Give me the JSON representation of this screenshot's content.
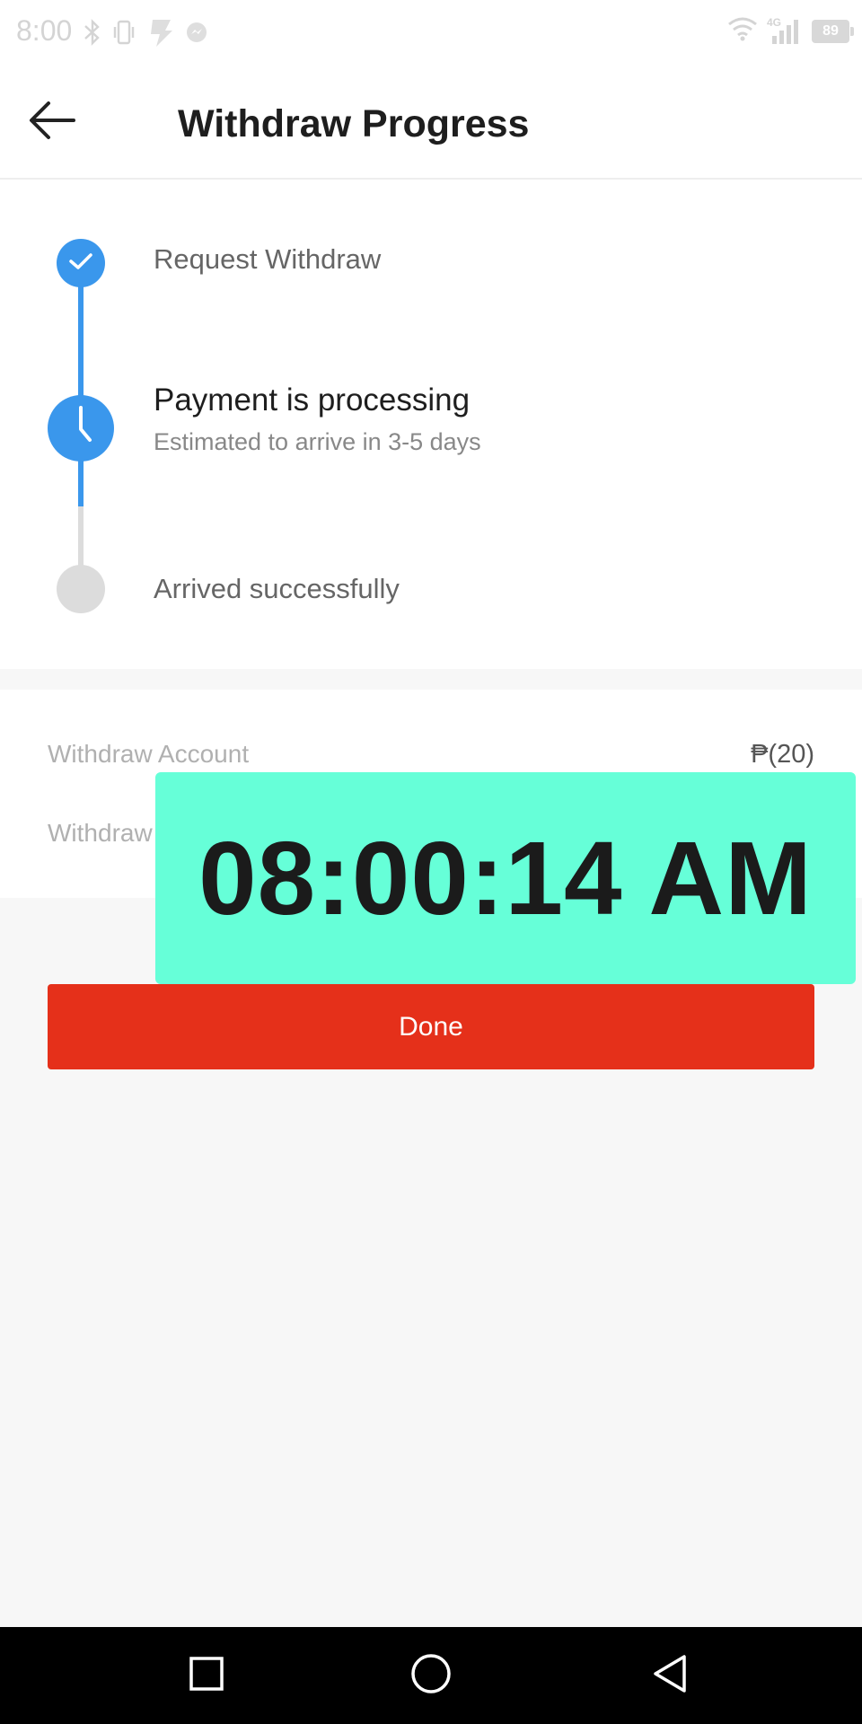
{
  "status_bar": {
    "time": "8:00",
    "battery_level": "89",
    "network_label": "4G",
    "icons": [
      "bluetooth-icon",
      "vibrate-icon",
      "app-notification-icon",
      "messenger-icon",
      "wifi-icon",
      "signal-icon",
      "battery-icon"
    ]
  },
  "header": {
    "back_icon": "arrow-left-icon",
    "title": "Withdraw Progress"
  },
  "progress": {
    "steps": [
      {
        "label": "Request Withdraw",
        "state": "done",
        "icon": "check-icon"
      },
      {
        "label": "Payment is processing",
        "subtitle": "Estimated to arrive in 3-5 days",
        "state": "current",
        "icon": "clock-icon"
      },
      {
        "label": "Arrived successfully",
        "state": "pending",
        "icon": "empty-circle-icon"
      }
    ],
    "colors": {
      "active": "#3a97ec",
      "pending": "#dcdcdc"
    }
  },
  "details": {
    "rows": [
      {
        "label": "Withdraw Account",
        "value": "₱(20)"
      },
      {
        "label": "Withdraw"
      }
    ]
  },
  "actions": {
    "done_label": "Done",
    "done_color": "#e5301a"
  },
  "overlay": {
    "time": "08:00:14 AM",
    "background": "#66ffd8"
  },
  "nav_bar": {
    "icons": [
      "recent-apps-icon",
      "home-icon",
      "back-triangle-icon"
    ]
  }
}
